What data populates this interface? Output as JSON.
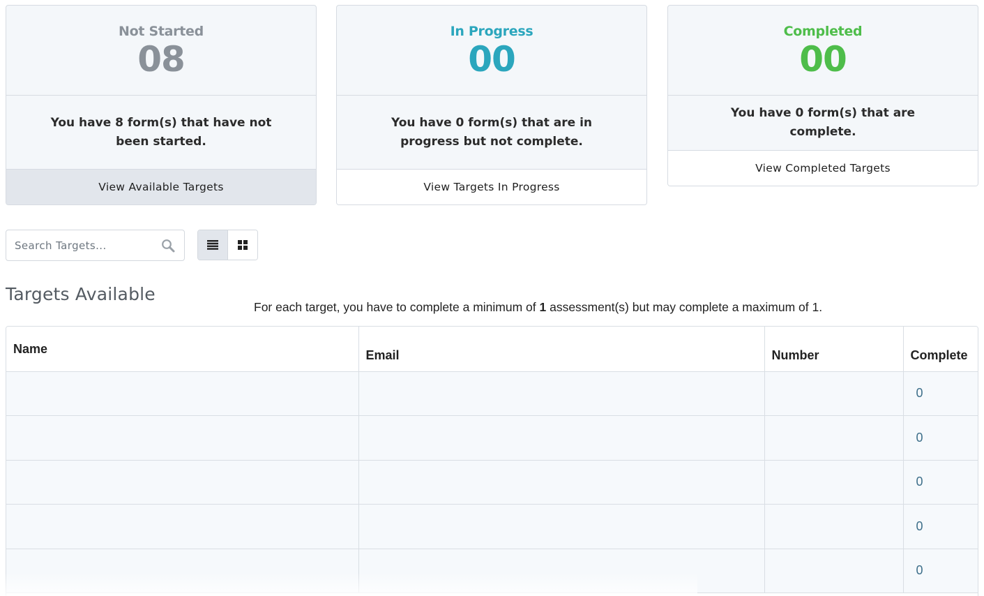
{
  "cards": [
    {
      "label": "Not Started",
      "count": "08",
      "message": "You have 8 form(s) that have not been started.",
      "action": "View Available Targets",
      "color": "#8a9199"
    },
    {
      "label": "In Progress",
      "count": "00",
      "message": "You have 0 form(s) that are in progress but not complete.",
      "action": "View Targets In Progress",
      "color": "#2ba6bd"
    },
    {
      "label": "Completed",
      "count": "00",
      "message": "You have 0 form(s) that are complete.",
      "action": "View Completed Targets",
      "color": "#4ebd4a"
    }
  ],
  "search": {
    "placeholder": "Search Targets...",
    "icon": "search-icon"
  },
  "view_toggle": {
    "list_icon": "list-view-icon",
    "grid_icon": "grid-view-icon",
    "active": "list"
  },
  "section": {
    "title": "Targets Available",
    "instruction_pre": "For each target, you have to complete a minimum of ",
    "instruction_min": "1",
    "instruction_post": " assessment(s) but may complete a maximum of 1."
  },
  "table": {
    "columns": [
      "Name",
      "Email",
      "Number",
      "Complete"
    ],
    "rows": [
      {
        "name": "",
        "email": "",
        "number": "",
        "complete": "0"
      },
      {
        "name": "",
        "email": "",
        "number": "",
        "complete": "0"
      },
      {
        "name": "",
        "email": "",
        "number": "",
        "complete": "0"
      },
      {
        "name": "",
        "email": "",
        "number": "",
        "complete": "0"
      },
      {
        "name": "",
        "email": "",
        "number": "",
        "complete": "0"
      }
    ]
  }
}
